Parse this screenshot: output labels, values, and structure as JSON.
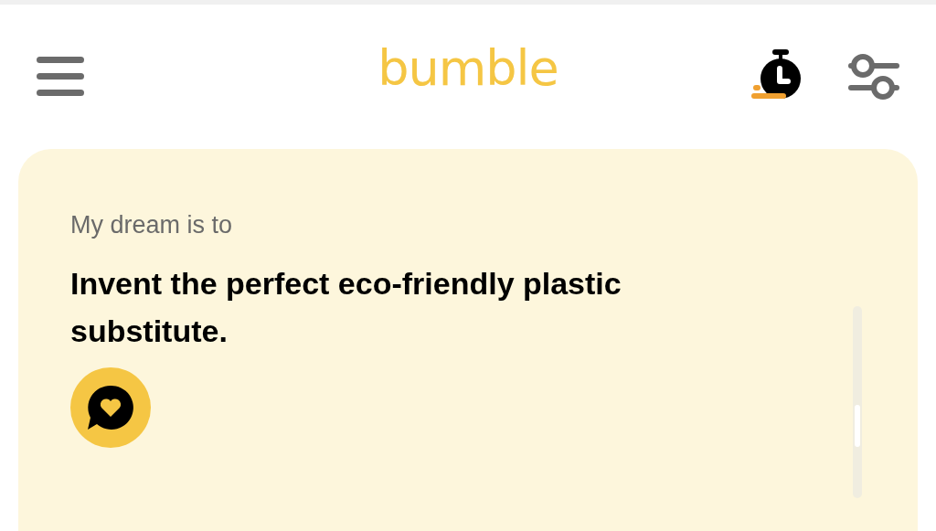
{
  "header": {
    "logo": "bumble"
  },
  "prompt": {
    "label": "My dream is to",
    "answer": "Invent the perfect eco-friendly plastic substitute."
  }
}
